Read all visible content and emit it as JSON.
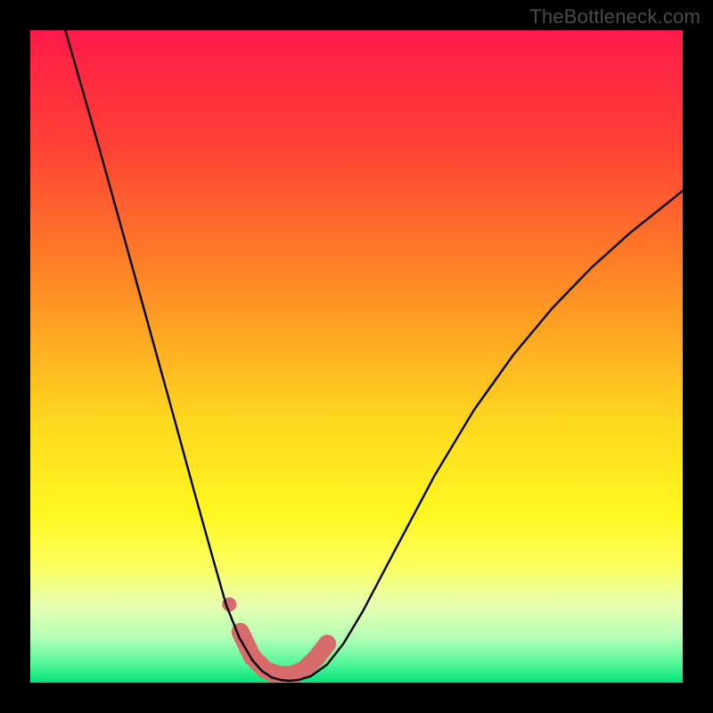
{
  "watermark": "TheBottleneck.com",
  "chart_data": {
    "type": "line",
    "title": "",
    "xlabel": "",
    "ylabel": "",
    "xlim": [
      0,
      1
    ],
    "ylim": [
      0,
      1
    ],
    "axes_visible": false,
    "gradient_stops": [
      {
        "offset": 0.0,
        "color": "#ff1a49"
      },
      {
        "offset": 0.18,
        "color": "#ff4235"
      },
      {
        "offset": 0.4,
        "color": "#ff8e24"
      },
      {
        "offset": 0.6,
        "color": "#ffd81f"
      },
      {
        "offset": 0.74,
        "color": "#fff721"
      },
      {
        "offset": 0.82,
        "color": "#fbff5d"
      },
      {
        "offset": 0.88,
        "color": "#e8ffb0"
      },
      {
        "offset": 0.93,
        "color": "#b6ffb6"
      },
      {
        "offset": 0.97,
        "color": "#56f79a"
      },
      {
        "offset": 1.0,
        "color": "#00e47a"
      }
    ],
    "series": [
      {
        "name": "bottleneck-curve",
        "x": [
          0.048,
          0.106,
          0.164,
          0.222,
          0.252,
          0.28,
          0.3,
          0.32,
          0.34,
          0.355,
          0.37,
          0.385,
          0.397,
          0.41,
          0.43,
          0.455,
          0.48,
          0.51,
          0.56,
          0.62,
          0.68,
          0.74,
          0.8,
          0.86,
          0.92,
          0.98,
          1.0
        ],
        "y": [
          1.02,
          0.818,
          0.61,
          0.4,
          0.29,
          0.19,
          0.12,
          0.07,
          0.035,
          0.018,
          0.008,
          0.004,
          0.003,
          0.004,
          0.01,
          0.028,
          0.06,
          0.11,
          0.205,
          0.318,
          0.418,
          0.502,
          0.574,
          0.636,
          0.69,
          0.738,
          0.754
        ]
      },
      {
        "name": "highlight-band",
        "stroke": "#d76b6b",
        "stroke_width": 20,
        "x": [
          0.322,
          0.34,
          0.36,
          0.38,
          0.4,
          0.42,
          0.44,
          0.455
        ],
        "y": [
          0.078,
          0.04,
          0.02,
          0.012,
          0.012,
          0.02,
          0.04,
          0.06
        ]
      }
    ],
    "markers": [
      {
        "name": "highlight-dot",
        "x": 0.305,
        "y": 0.12,
        "r": 8,
        "color": "#d76b6b"
      }
    ]
  }
}
